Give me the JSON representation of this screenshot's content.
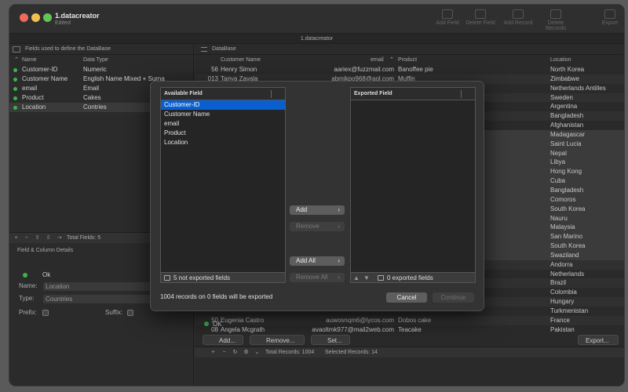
{
  "window": {
    "title": "1.datacreator",
    "subtitle": "Edited",
    "doc_title": "1.datacreator"
  },
  "toolbar": {
    "add_field": "Add Field",
    "delete_field": "Delete Field",
    "add_record": "Add Record",
    "delete_records": "Delete Records",
    "export": "Export"
  },
  "fields_pane": {
    "header": "Fields used to define the DataBase",
    "col_name": "Name",
    "col_type": "Data Type",
    "rows": [
      {
        "name": "Customer-ID",
        "type": "Numeric"
      },
      {
        "name": "Customer Name",
        "type": "English Name Mixed + Surna"
      },
      {
        "name": "email",
        "type": "Email"
      },
      {
        "name": "Product",
        "type": "Cakes"
      },
      {
        "name": "Location",
        "type": "Contries"
      }
    ],
    "total": "Total Fields: 5"
  },
  "details": {
    "title": "Field & Column Details",
    "status": "Ok",
    "name_label": "Name:",
    "name_value": "Location",
    "type_label": "Type:",
    "type_value": "Countries",
    "prefix_label": "Prefix:",
    "suffix_label": "Suffix:"
  },
  "database": {
    "header": "DataBase",
    "cols": {
      "name": "Customer Name",
      "email": "email",
      "product": "Product",
      "location": "Location"
    },
    "rows": [
      {
        "id": "56",
        "name": "Henry Simon",
        "email": "aariex@fuzzmail.com",
        "product": "Banoffee pie",
        "location": "North Korea"
      },
      {
        "id": "013",
        "name": "Tanya Zavala",
        "email": "abmjkpo968@aol.com",
        "product": "Muffin",
        "location": "Zimbabwe"
      },
      {
        "id": "",
        "name": "",
        "email": "",
        "product": "",
        "location": "Netherlands Antilles"
      },
      {
        "id": "",
        "name": "",
        "email": "",
        "product": "",
        "location": "Sweden"
      },
      {
        "id": "",
        "name": "",
        "email": "",
        "product": "",
        "location": "Argentina"
      },
      {
        "id": "",
        "name": "",
        "email": "",
        "product": "",
        "location": "Bangladesh"
      },
      {
        "id": "",
        "name": "",
        "email": "",
        "product": "",
        "location": "Afghanistan"
      },
      {
        "id": "",
        "name": "",
        "email": "",
        "product": "",
        "location": "Madagascar"
      },
      {
        "id": "",
        "name": "",
        "email": "",
        "product": "",
        "location": "Saint Lucia"
      },
      {
        "id": "",
        "name": "",
        "email": "",
        "product": "",
        "location": "Nepal"
      },
      {
        "id": "",
        "name": "",
        "email": "",
        "product": "",
        "location": "Libya"
      },
      {
        "id": "",
        "name": "",
        "email": "",
        "product": "",
        "location": "Hong Kong"
      },
      {
        "id": "",
        "name": "",
        "email": "",
        "product": "",
        "location": "Cuba"
      },
      {
        "id": "",
        "name": "",
        "email": "",
        "product": "",
        "location": "Bangladesh"
      },
      {
        "id": "",
        "name": "",
        "email": "",
        "product": "",
        "location": "Comoros"
      },
      {
        "id": "",
        "name": "",
        "email": "",
        "product": "",
        "location": "South Korea"
      },
      {
        "id": "",
        "name": "",
        "email": "",
        "product": "",
        "location": "Nauru"
      },
      {
        "id": "",
        "name": "",
        "email": "",
        "product": "",
        "location": "Malaysia"
      },
      {
        "id": "",
        "name": "",
        "email": "",
        "product": "",
        "location": "San Marino"
      },
      {
        "id": "",
        "name": "",
        "email": "",
        "product": "",
        "location": "South Korea"
      },
      {
        "id": "",
        "name": "",
        "email": "",
        "product": "",
        "location": "Swaziland"
      },
      {
        "id": "",
        "name": "",
        "email": "",
        "product": "",
        "location": "Andorra"
      },
      {
        "id": "",
        "name": "",
        "email": "",
        "product": "",
        "location": "Netherlands"
      },
      {
        "id": "",
        "name": "",
        "email": "",
        "product": "",
        "location": "Brazil"
      },
      {
        "id": "",
        "name": "",
        "email": "",
        "product": "",
        "location": "Colombia"
      },
      {
        "id": "",
        "name": "",
        "email": "",
        "product": "",
        "location": "Hungary"
      },
      {
        "id": "",
        "name": "",
        "email": "",
        "product": "",
        "location": "Turkmenistan"
      },
      {
        "id": "50",
        "name": "Eugenia Castro",
        "email": "auwosnqm6@lycos.com",
        "product": "Dobos cake",
        "location": "France"
      },
      {
        "id": "08",
        "name": "Angela Mcgrath",
        "email": "avaoltmk977@mail2web.com",
        "product": "Teacake",
        "location": "Pakistan"
      }
    ],
    "total_records": "Total Records: 1004",
    "selected_records": "Selected Records: 14",
    "status": "OK",
    "add_btn": "Add...",
    "remove_btn": "Remove...",
    "set_btn": "Set...",
    "export_btn": "Export..."
  },
  "dialog": {
    "available_header": "Available Field",
    "available_items": [
      "Customer-ID",
      "Customer Name",
      "email",
      "Product",
      "Location"
    ],
    "available_footer": "5 not exported fields",
    "exported_header": "Exported Field",
    "exported_footer": "0 exported fields",
    "add": "Add",
    "remove": "Remove",
    "add_all": "Add All",
    "remove_all": "Remove All",
    "status": "1004 records on 0 fields will be exported",
    "cancel": "Cancel",
    "continue": "Continue"
  }
}
